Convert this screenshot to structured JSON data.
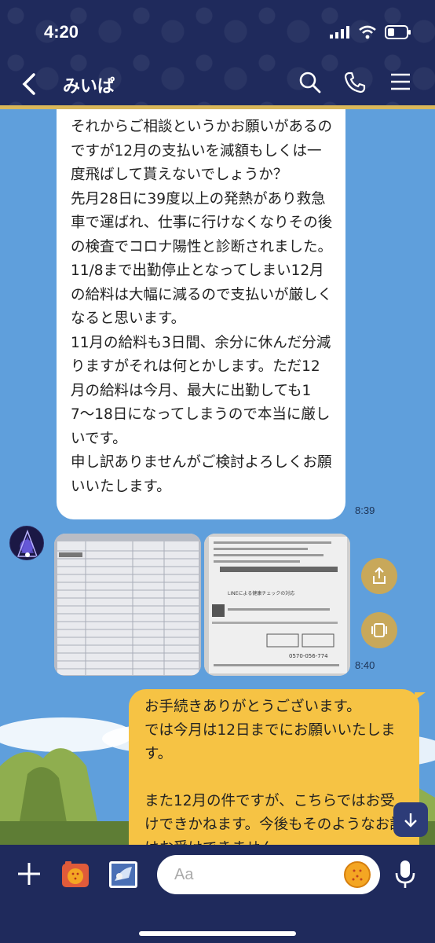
{
  "status": {
    "time": "4:20"
  },
  "header": {
    "title": "みいぱ"
  },
  "messages": {
    "incoming_text": "それからご相談というかお願いがあるのですが12月の支払いを減額もしくは一度飛ばして貰えないでしょうか？\n先月28日に39度以上の発熱があり救急車で運ばれ、仕事に行けなくなりその後の検査でコロナ陽性と診断されました。11/8まで出勤停止となってしまい12月の給料は大幅に減るので支払いが厳しくなると思います。\n11月の給料も3日間、余分に休んだ分減りますがそれは何とかします。ただ12月の給料は今月、最大に出勤しても17〜18日になってしまうので本当に厳しいです。\n申し訳ありませんがご検討よろしくお願いいたします。",
    "incoming_time": "8:39",
    "photos_time": "8:40",
    "outgoing_text": "お手続きありがとうございます。\nでは今月は12日までにお願いいたします。\n\nまた12月の件ですが、こちらではお受けできかねます。今後もそのようなお話はお受けできません"
  },
  "photo2": {
    "heading": "LINEによる健康チェックの対応",
    "phone": "0570-056-774"
  },
  "input": {
    "placeholder": "Aa"
  },
  "colors": {
    "header_bg": "#1f2a5c",
    "chat_bg": "#5f9fdc",
    "outgoing_bubble": "#f6c344",
    "accent_gold": "#c8a85a"
  }
}
